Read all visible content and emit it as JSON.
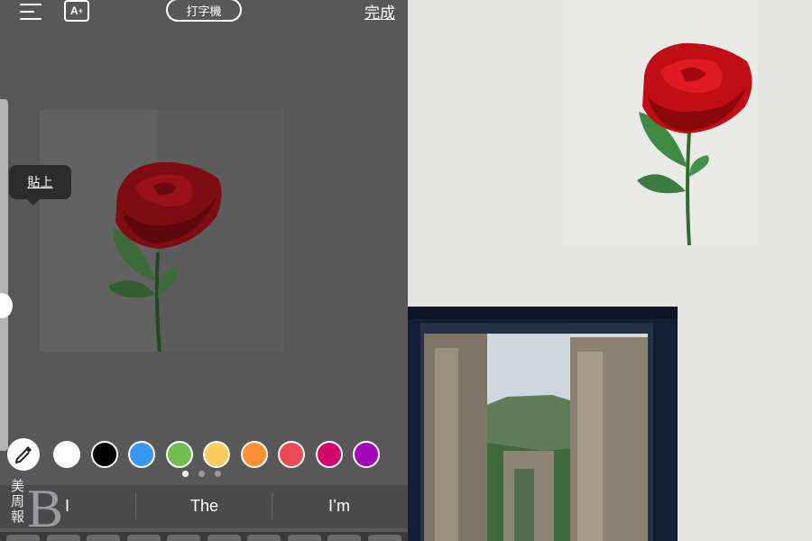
{
  "editor": {
    "font_style_label": "A",
    "font_style_plus": "+",
    "font_name": "打字機",
    "done_label": "完成",
    "paste_label": "貼上"
  },
  "colors": [
    {
      "name": "white",
      "hex": "#ffffff"
    },
    {
      "name": "black",
      "hex": "#000000"
    },
    {
      "name": "blue",
      "hex": "#3897f0"
    },
    {
      "name": "green",
      "hex": "#70c050"
    },
    {
      "name": "yellow",
      "hex": "#fdcb5c"
    },
    {
      "name": "orange",
      "hex": "#fd8d32"
    },
    {
      "name": "red",
      "hex": "#ed4956"
    },
    {
      "name": "pink",
      "hex": "#d10869"
    },
    {
      "name": "purple",
      "hex": "#a307ba"
    }
  ],
  "color_pages": {
    "total": 3,
    "current": 1
  },
  "keyboard": {
    "suggestions": [
      "I",
      "The",
      "I’m"
    ]
  },
  "watermark": {
    "line1": "美",
    "line2": "周",
    "line3": "報",
    "letter": "B"
  }
}
